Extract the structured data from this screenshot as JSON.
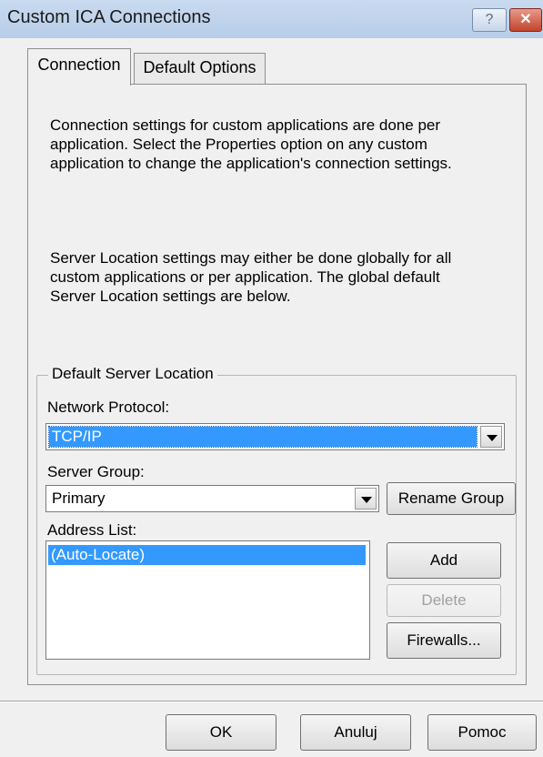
{
  "window": {
    "title": "Custom ICA Connections",
    "help_glyph": "?",
    "close_glyph": "✕"
  },
  "tabs": [
    {
      "label": "Connection",
      "selected": true
    },
    {
      "label": "Default Options",
      "selected": false
    }
  ],
  "connection": {
    "intro_text": "Connection settings for custom applications are done per\napplication.  Select the Properties option on any custom\napplication to change the application's connection settings.",
    "server_location_text": "Server Location settings may either be done globally for all\ncustom applications or per application.  The global default\nServer Location settings are below.",
    "group_title": "Default Server Location",
    "network_protocol_label": "Network Protocol:",
    "network_protocol_value": "TCP/IP",
    "server_group_label": "Server Group:",
    "server_group_value": "Primary",
    "rename_group_label": "Rename Group",
    "address_list_label": "Address List:",
    "address_list_items": [
      "(Auto-Locate)"
    ],
    "add_label": "Add",
    "delete_label": "Delete",
    "firewalls_label": "Firewalls..."
  },
  "footer": {
    "ok_label": "OK",
    "cancel_label": "Anuluj",
    "help_label": "Pomoc"
  },
  "colors": {
    "titlebar": "#c9daf0",
    "selection": "#3399ff",
    "close_button": "#c2432c"
  },
  "icons": {
    "help": "help-icon",
    "close": "close-icon",
    "dropdown": "chevron-down-icon"
  }
}
